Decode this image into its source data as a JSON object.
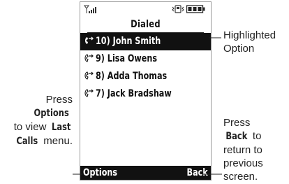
{
  "screen": {
    "title": "Dialed",
    "items": [
      {
        "label": "10) John Smith",
        "highlighted": true,
        "icon": "outgoing-call-icon"
      },
      {
        "label": "9) Lisa Owens",
        "highlighted": false,
        "icon": "outgoing-call-icon"
      },
      {
        "label": "8) Adda Thomas",
        "highlighted": false,
        "icon": "outgoing-call-icon"
      },
      {
        "label": "7) Jack Bradshaw",
        "highlighted": false,
        "icon": "outgoing-call-icon"
      }
    ],
    "softkeys": {
      "left": "Options",
      "right": "Back"
    },
    "status_icons": [
      "signal-strength-icon",
      "vibrate-icon",
      "battery-icon"
    ]
  },
  "callouts": {
    "highlight": [
      "Highlighted",
      "Option"
    ],
    "options": {
      "line1": "Press",
      "key": "Options",
      "line3a": "to view",
      "key2a": "Last",
      "key2b": "Calls",
      "line4": "menu."
    },
    "back": {
      "line1": "Press",
      "key": "Back",
      "to": "to",
      "line3": "return to",
      "line4": "previous",
      "line5": "screen."
    }
  },
  "colors": {
    "highlight_bg": "#111111",
    "highlight_fg": "#ffffff",
    "frame": "#9a9a9a"
  }
}
